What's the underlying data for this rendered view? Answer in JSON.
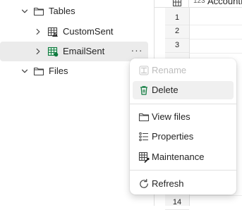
{
  "tree": {
    "items": [
      {
        "label": "Tables",
        "expanded": true,
        "icon": "folder-icon"
      },
      {
        "label": "CustomSent",
        "expanded": false,
        "icon": "delta-table-warning-icon"
      },
      {
        "label": "EmailSent",
        "expanded": false,
        "icon": "delta-table-icon",
        "selected": true,
        "more": "···"
      },
      {
        "label": "Files",
        "expanded": true,
        "icon": "folder-icon"
      }
    ]
  },
  "grid": {
    "column_type_label": "123",
    "column_name": "AccountId",
    "row_numbers": [
      "1",
      "2",
      "3",
      "14"
    ]
  },
  "context_menu": {
    "items": [
      {
        "label": "Rename",
        "icon": "rename-icon",
        "disabled": true
      },
      {
        "label": "Delete",
        "icon": "trash-icon",
        "hovered": true
      },
      {
        "label": "View files",
        "icon": "folder-icon"
      },
      {
        "label": "Properties",
        "icon": "properties-list-icon"
      },
      {
        "label": "Maintenance",
        "icon": "table-wrench-icon"
      },
      {
        "label": "Refresh",
        "icon": "refresh-icon"
      }
    ]
  },
  "colors": {
    "selected_row": "#ebebeb",
    "menu_hover": "#f0f0f0",
    "delta_icon_green": "#0f7b3f",
    "disabled_text": "#bdbdbd"
  }
}
